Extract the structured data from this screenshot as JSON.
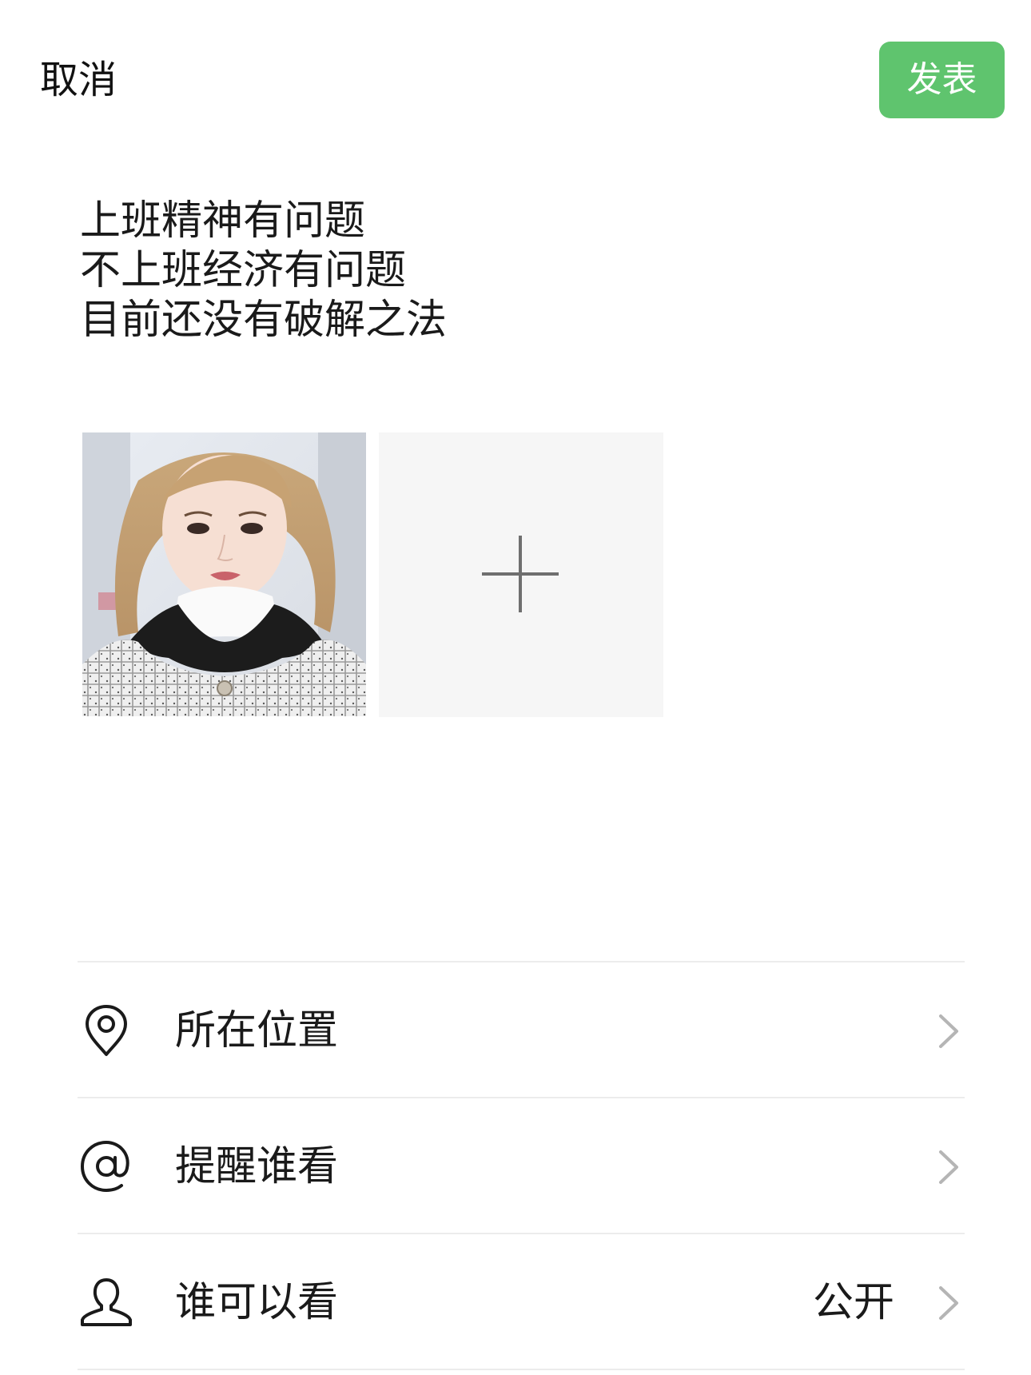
{
  "header": {
    "cancel_label": "取消",
    "publish_label": "发表"
  },
  "post": {
    "lines": [
      "上班精神有问题",
      "不上班经济有问题",
      "目前还没有破解之法"
    ]
  },
  "media": {
    "photo_count": 1,
    "add_icon": "plus-icon"
  },
  "options": [
    {
      "icon": "location-pin-icon",
      "label": "所在位置",
      "value": ""
    },
    {
      "icon": "at-sign-icon",
      "label": "提醒谁看",
      "value": ""
    },
    {
      "icon": "person-icon",
      "label": "谁可以看",
      "value": "公开"
    }
  ],
  "colors": {
    "publish_button": "#5fc46e",
    "add_tile_bg": "#f6f6f6",
    "divider": "#ececec",
    "chevron": "#b5b5b5"
  }
}
